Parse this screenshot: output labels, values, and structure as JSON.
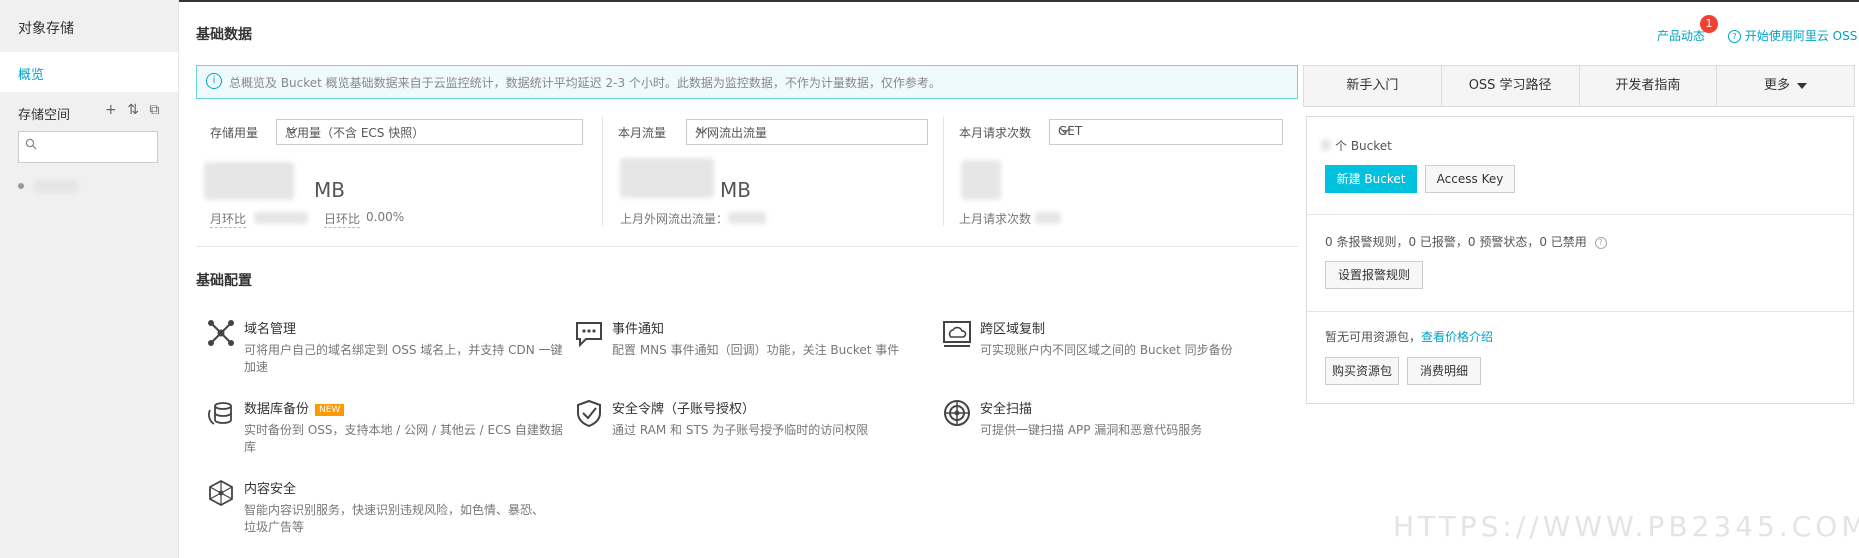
{
  "sidebar": {
    "title": "对象存储",
    "overview_label": "概览",
    "storage_label": "存储空间",
    "tools": [
      "+",
      "⇅",
      "⧉"
    ],
    "search_placeholder": ""
  },
  "header": {
    "title": "基础数据",
    "product_news": "产品动态",
    "badge_count": "1",
    "start_link": "开始使用阿里云 OSS"
  },
  "notice": "总概览及 Bucket 概览基础数据来自于云监控统计，数据统计平均延迟 2-3 个小时。此数据为监控数据，不作为计量数据，仅作参考。",
  "stats": [
    {
      "label": "存储用量",
      "select": "总用量（不含 ECS 快照）",
      "unit": "MB",
      "mom_label": "月环比",
      "dod_label": "日环比",
      "dod_value": "0.00%"
    },
    {
      "label": "本月流量",
      "select": "外网流出流量",
      "unit": "MB",
      "last_label": "上月外网流出流量："
    },
    {
      "label": "本月请求次数",
      "select": "GET",
      "last_label": "上月请求次数"
    }
  ],
  "config": {
    "title": "基础配置",
    "items": [
      {
        "name": "域名管理",
        "desc": "可将用户自己的域名绑定到 OSS 域名上，并支持 CDN 一键加速",
        "icon": "network-icon"
      },
      {
        "name": "事件通知",
        "desc": "配置 MNS 事件通知（回调）功能，关注 Bucket 事件",
        "icon": "message-icon"
      },
      {
        "name": "跨区域复制",
        "desc": "可实现账户内不同区域之间的 Bucket 同步备份",
        "icon": "cloud-sync-icon"
      },
      {
        "name": "数据库备份",
        "new_badge": "NEW",
        "desc": "实时备份到 OSS，支持本地 / 公网 / 其他云 / ECS 自建数据库",
        "icon": "database-icon"
      },
      {
        "name": "安全令牌（子账号授权）",
        "desc": "通过 RAM 和 STS 为子账号授予临时的访问权限",
        "icon": "shield-icon"
      },
      {
        "name": "安全扫描",
        "desc": "可提供一键扫描 APP 漏洞和恶意代码服务",
        "icon": "scan-icon"
      },
      {
        "name": "内容安全",
        "desc": "智能内容识别服务，快速识别违规风险，如色情、暴恐、垃圾广告等",
        "icon": "cube-icon"
      }
    ]
  },
  "right": {
    "tabs": [
      "新手入门",
      "OSS 学习路径",
      "开发者指南",
      "更多"
    ],
    "bucket_label": "个 Bucket",
    "new_bucket": "新建 Bucket",
    "access_key": "Access Key",
    "alarm_text": "0 条报警规则，0 已报警，0 预警状态，0 已禁用",
    "alarm_button": "设置报警规则",
    "package_text": "暂无可用资源包，",
    "package_link": "查看价格介绍",
    "buy_button": "购买资源包",
    "bill_button": "消费明细"
  },
  "watermark": "HTTPS://WWW.PB2345.COM"
}
